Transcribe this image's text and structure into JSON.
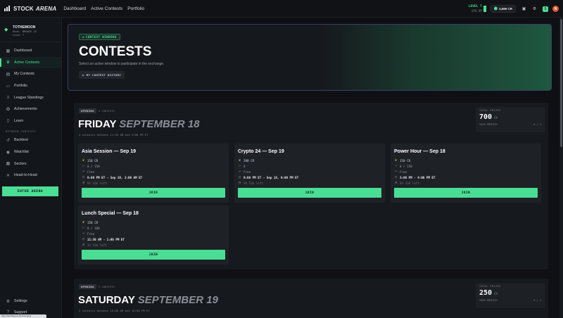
{
  "app": {
    "logo_stock": "STOCK",
    "logo_arena": "ARENA",
    "nav": [
      "Dashboard",
      "Active Contests",
      "Portfolio"
    ],
    "level_label": "LEVEL 7",
    "xp_label": "878 XP",
    "balance": "3,696 CR",
    "notifications": "5",
    "avatar_initial": "N",
    "colors": {
      "accent": "#4ade94",
      "background": "#0e1013",
      "hero_border": "#3b3e69",
      "avatar": "#e0552f"
    }
  },
  "sidebar": {
    "username": "TOTHEMOON",
    "rank": "Rank: BRONZE IV",
    "level": "Level 7",
    "items": [
      {
        "label": "Dashboard",
        "icon": "dashboard-icon"
      },
      {
        "label": "Active Contests",
        "icon": "trophy-icon"
      },
      {
        "label": "My Contests",
        "icon": "briefcase-icon"
      },
      {
        "label": "Portfolio",
        "icon": "folder-icon"
      },
      {
        "label": "League Standings",
        "icon": "standings-icon"
      },
      {
        "label": "Achievements",
        "icon": "medal-icon"
      },
      {
        "label": "Learn",
        "icon": "book-icon"
      }
    ],
    "section_label": "BETWEEN CONTESTS",
    "items2": [
      {
        "label": "Backtest",
        "icon": "backtest-icon"
      },
      {
        "label": "Watchlist",
        "icon": "eye-icon"
      },
      {
        "label": "Sectors",
        "icon": "grid-icon"
      },
      {
        "label": "Head-to-Head",
        "icon": "versus-icon"
      }
    ],
    "enter_arena": "ENTER ARENA",
    "bottom": [
      {
        "label": "Settings",
        "icon": "gear-icon"
      },
      {
        "label": "Support",
        "icon": "help-icon"
      }
    ],
    "status_url": "https://stockarena.com/contests"
  },
  "hero": {
    "badge": "CONTEST WINDOWS",
    "title": "CONTESTS",
    "subtitle": "Select an active window to participate in the exchange.",
    "history_button": "MY CONTEST HISTORY"
  },
  "days": [
    {
      "tag": "OPENING",
      "count": "4 CONTESTS",
      "day": "FRIDAY",
      "date": "SEPTEMBER 18",
      "window": "4 contests between 11:30 AM and 9:00 PM ET",
      "prize_label": "TOTAL PRIZES",
      "prize_value": "700",
      "prize_unit": "CR",
      "entries_label": "YOUR ENTRIES",
      "entries_value": "0 / 4",
      "contests": [
        {
          "name": "Asia Session — Sep 19",
          "prize": "150 CR",
          "entries": "0 / 150",
          "fee": "Free",
          "time": "8:00 PM ET - Sep 19, 2:00 AM ET",
          "left": "9h 52m left",
          "join": "JOIN"
        },
        {
          "name": "Crypto 24 — Sep 19",
          "prize": "200 CR",
          "entries": "0",
          "fee": "Free",
          "time": "9:00 PM ET - Sep 18, 9:00 PM ET",
          "left": "9h 52m left",
          "join": "JOIN"
        },
        {
          "name": "Power Hour — Sep 18",
          "prize": "150 CR",
          "entries": "0 / 150",
          "fee": "Free",
          "time": "3:00 PM - 4:00 PM ET",
          "left": "9h 52m left",
          "join": "JOIN"
        },
        {
          "name": "Lunch Special — Sep 18",
          "prize": "150 CR",
          "entries": "0 / 100",
          "fee": "Free",
          "time": "11:30 AM - 1:00 PM ET",
          "left": "1h 52m left",
          "join": "JOIN"
        }
      ]
    },
    {
      "tag": "OPENING",
      "count": "2 CONTESTS",
      "day": "SATURDAY",
      "date": "SEPTEMBER 19",
      "window": "2 contests between 10:00 AM and 10:00 PM ET",
      "prize_label": "TOTAL PRIZES",
      "prize_value": "250",
      "prize_unit": "CR",
      "entries_label": "YOUR ENTRIES",
      "entries_value": "0 / 2"
    }
  ]
}
